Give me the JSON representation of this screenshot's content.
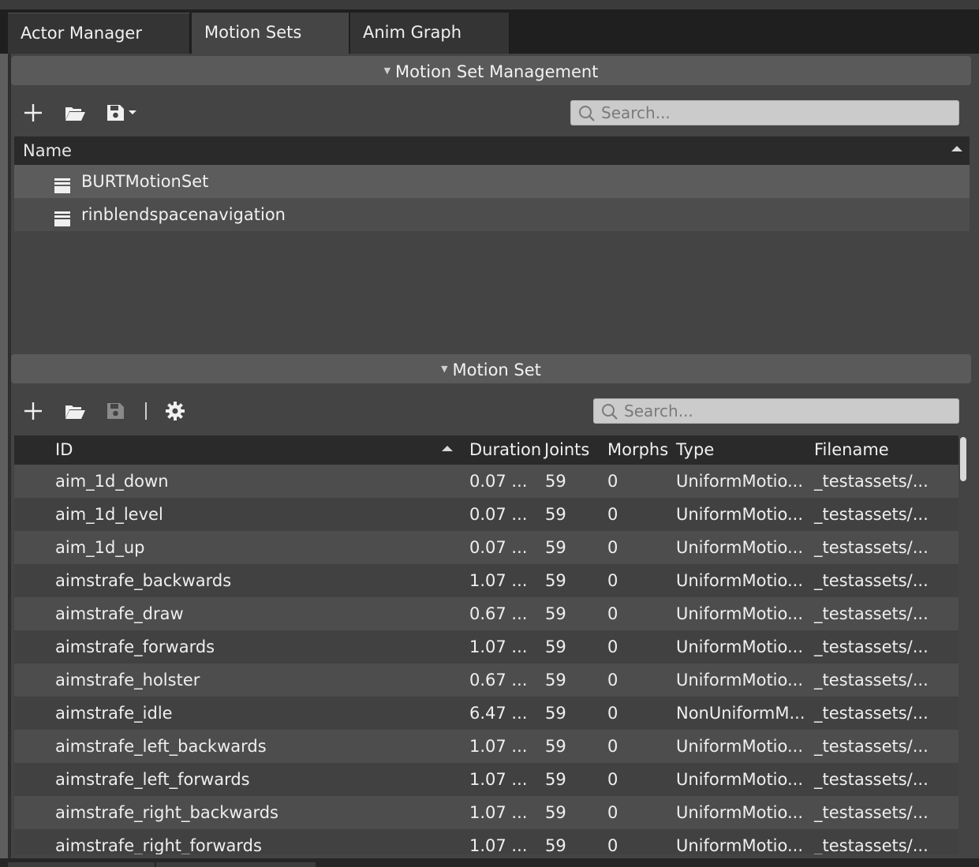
{
  "tabs": [
    {
      "label": "Actor Manager"
    },
    {
      "label": "Motion Sets"
    },
    {
      "label": "Anim Graph"
    }
  ],
  "management": {
    "title": "Motion Set Management",
    "search_placeholder": "Search...",
    "name_header": "Name",
    "sets": [
      {
        "name": "BURTMotionSet",
        "selected": true
      },
      {
        "name": "rinblendspacenavigation",
        "selected": false
      }
    ]
  },
  "motion_set": {
    "title": "Motion Set",
    "search_placeholder": "Search...",
    "columns": [
      "ID",
      "Duration",
      "Joints",
      "Morphs",
      "Type",
      "Filename"
    ],
    "rows": [
      {
        "id": "aim_1d_down",
        "duration": "0.07 ...",
        "joints": "59",
        "morphs": "0",
        "type": "UniformMotio...",
        "filename": "_testassets/..."
      },
      {
        "id": "aim_1d_level",
        "duration": "0.07 ...",
        "joints": "59",
        "morphs": "0",
        "type": "UniformMotio...",
        "filename": "_testassets/..."
      },
      {
        "id": "aim_1d_up",
        "duration": "0.07 ...",
        "joints": "59",
        "morphs": "0",
        "type": "UniformMotio...",
        "filename": "_testassets/..."
      },
      {
        "id": "aimstrafe_backwards",
        "duration": "1.07 ...",
        "joints": "59",
        "morphs": "0",
        "type": "UniformMotio...",
        "filename": "_testassets/..."
      },
      {
        "id": "aimstrafe_draw",
        "duration": "0.67 ...",
        "joints": "59",
        "morphs": "0",
        "type": "UniformMotio...",
        "filename": "_testassets/..."
      },
      {
        "id": "aimstrafe_forwards",
        "duration": "1.07 ...",
        "joints": "59",
        "morphs": "0",
        "type": "UniformMotio...",
        "filename": "_testassets/..."
      },
      {
        "id": "aimstrafe_holster",
        "duration": "0.67 ...",
        "joints": "59",
        "morphs": "0",
        "type": "UniformMotio...",
        "filename": "_testassets/..."
      },
      {
        "id": "aimstrafe_idle",
        "duration": "6.47 ...",
        "joints": "59",
        "morphs": "0",
        "type": "NonUniformM...",
        "filename": "_testassets/..."
      },
      {
        "id": "aimstrafe_left_backwards",
        "duration": "1.07 ...",
        "joints": "59",
        "morphs": "0",
        "type": "UniformMotio...",
        "filename": "_testassets/..."
      },
      {
        "id": "aimstrafe_left_forwards",
        "duration": "1.07 ...",
        "joints": "59",
        "morphs": "0",
        "type": "UniformMotio...",
        "filename": "_testassets/..."
      },
      {
        "id": "aimstrafe_right_backwards",
        "duration": "1.07 ...",
        "joints": "59",
        "morphs": "0",
        "type": "UniformMotio...",
        "filename": "_testassets/..."
      },
      {
        "id": "aimstrafe_right_forwards",
        "duration": "1.07 ...",
        "joints": "59",
        "morphs": "0",
        "type": "UniformMotio...",
        "filename": "_testassets/..."
      }
    ]
  },
  "icons": {
    "add": "plus-icon",
    "open": "folder-open-icon",
    "save": "save-icon",
    "settings": "gear-icon",
    "search": "search-icon",
    "motion_set": "motion-set-icon"
  },
  "colors": {
    "panel": "#444444",
    "header_bar": "#5a5a5a",
    "selected_row": "#5c5c5c",
    "search_bg": "#cbcbcb"
  }
}
